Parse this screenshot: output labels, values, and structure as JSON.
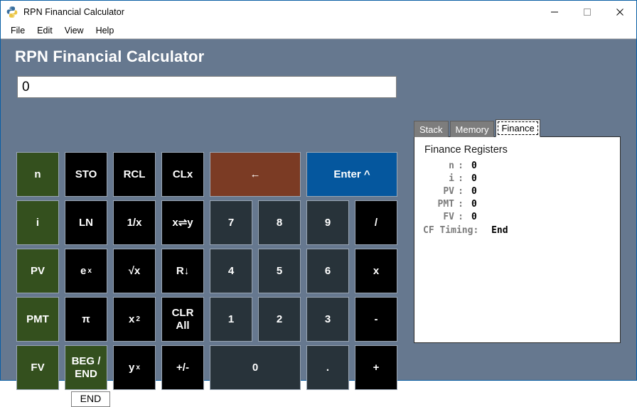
{
  "window": {
    "title": "RPN Financial Calculator",
    "icon": "python-logo-icon",
    "controls": {
      "minimize": "minimize-icon",
      "maximize": "maximize-icon",
      "close": "close-icon"
    }
  },
  "menubar": {
    "items": [
      {
        "label": "File"
      },
      {
        "label": "Edit"
      },
      {
        "label": "View"
      },
      {
        "label": "Help"
      }
    ]
  },
  "header": {
    "page_title": "RPN Financial Calculator"
  },
  "display": {
    "value": "0"
  },
  "keypad": {
    "keys": [
      {
        "label": "n",
        "style": "fin"
      },
      {
        "label": "STO",
        "style": "fn"
      },
      {
        "label": "RCL",
        "style": "fn"
      },
      {
        "label": "CLx",
        "style": "fn"
      },
      {
        "label": "←",
        "style": "back",
        "span": 2
      },
      {
        "label": "Enter ^",
        "style": "enter",
        "span": 2
      },
      {
        "label": "i",
        "style": "fin"
      },
      {
        "label": "LN",
        "style": "fn"
      },
      {
        "label": "1/x",
        "style": "fn"
      },
      {
        "label": "x⇌y",
        "style": "fn"
      },
      {
        "label": "7",
        "style": "digit"
      },
      {
        "label": "8",
        "style": "digit"
      },
      {
        "label": "9",
        "style": "digit"
      },
      {
        "label": "/",
        "style": "fn"
      },
      {
        "label": "PV",
        "style": "fin"
      },
      {
        "label": "e",
        "sup": "x",
        "style": "fn"
      },
      {
        "label": "√x",
        "style": "fn"
      },
      {
        "label": "R↓",
        "style": "fn"
      },
      {
        "label": "4",
        "style": "digit"
      },
      {
        "label": "5",
        "style": "digit"
      },
      {
        "label": "6",
        "style": "digit"
      },
      {
        "label": "x",
        "style": "fn"
      },
      {
        "label": "PMT",
        "style": "fin"
      },
      {
        "label": "π",
        "style": "fn"
      },
      {
        "label": "x",
        "sup": "2",
        "style": "fn"
      },
      {
        "label": "CLR\nAll",
        "style": "fn"
      },
      {
        "label": "1",
        "style": "digit"
      },
      {
        "label": "2",
        "style": "digit"
      },
      {
        "label": "3",
        "style": "digit"
      },
      {
        "label": "-",
        "style": "fn"
      },
      {
        "label": "FV",
        "style": "fin"
      },
      {
        "label": "BEG /\nEND",
        "style": "fin"
      },
      {
        "label": "y",
        "sup": "x",
        "style": "fn"
      },
      {
        "label": "+/-",
        "style": "fn"
      },
      {
        "label": "0",
        "style": "digit",
        "span": 2
      },
      {
        "label": ".",
        "style": "digit"
      },
      {
        "label": "+",
        "style": "fn"
      }
    ]
  },
  "cf_timing_status": {
    "label": "CF Timing:",
    "value": "END"
  },
  "side_panel": {
    "tabs": [
      {
        "label": "Stack",
        "active": false
      },
      {
        "label": "Memory",
        "active": false
      },
      {
        "label": "Finance",
        "active": true
      }
    ],
    "finance": {
      "heading": "Finance Registers",
      "registers": [
        {
          "name": "n",
          "colon": ":",
          "value": "0"
        },
        {
          "name": "i",
          "colon": ":",
          "value": "0"
        },
        {
          "name": "PV",
          "colon": ":",
          "value": "0"
        },
        {
          "name": "PMT",
          "colon": ":",
          "value": "0"
        },
        {
          "name": "FV",
          "colon": ":",
          "value": "0"
        }
      ],
      "cf_timing_label": "CF Timing:",
      "cf_timing_value": "End"
    }
  },
  "colors": {
    "background": "#66788f",
    "frame_border": "#0a5fa5",
    "financial_key": "#34501e",
    "function_key": "#000000",
    "digit_key": "#28333a",
    "backspace_key": "#7b3b24",
    "enter_key": "#05579e"
  }
}
